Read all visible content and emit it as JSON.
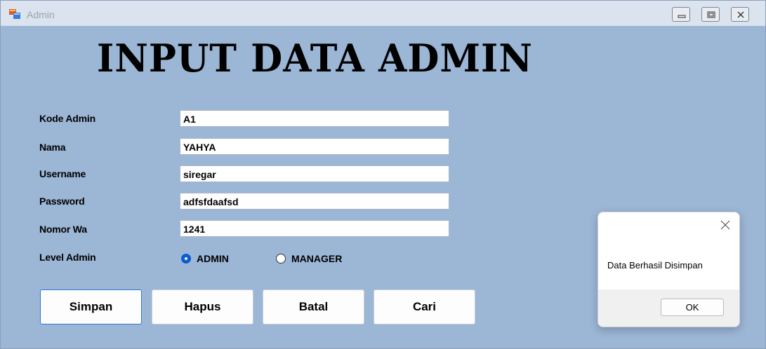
{
  "window": {
    "title": "Admin"
  },
  "heading": "INPUT DATA ADMIN",
  "form": {
    "fields": [
      {
        "label": "Kode Admin",
        "value": "A1"
      },
      {
        "label": "Nama",
        "value": "YAHYA"
      },
      {
        "label": "Username",
        "value": "siregar"
      },
      {
        "label": "Password",
        "value": "adfsfdaafsd"
      },
      {
        "label": "Nomor Wa",
        "value": "1241"
      }
    ],
    "level": {
      "label": "Level Admin",
      "options": [
        {
          "label": "ADMIN",
          "selected": true
        },
        {
          "label": "MANAGER",
          "selected": false
        }
      ]
    }
  },
  "buttons": {
    "simpan": "Simpan",
    "hapus": "Hapus",
    "batal": "Batal",
    "cari": "Cari"
  },
  "dialog": {
    "message": "Data Berhasil Disimpan",
    "ok_label": "OK"
  },
  "colors": {
    "background": "#9cb6d6",
    "accent": "#0a5dd1"
  }
}
